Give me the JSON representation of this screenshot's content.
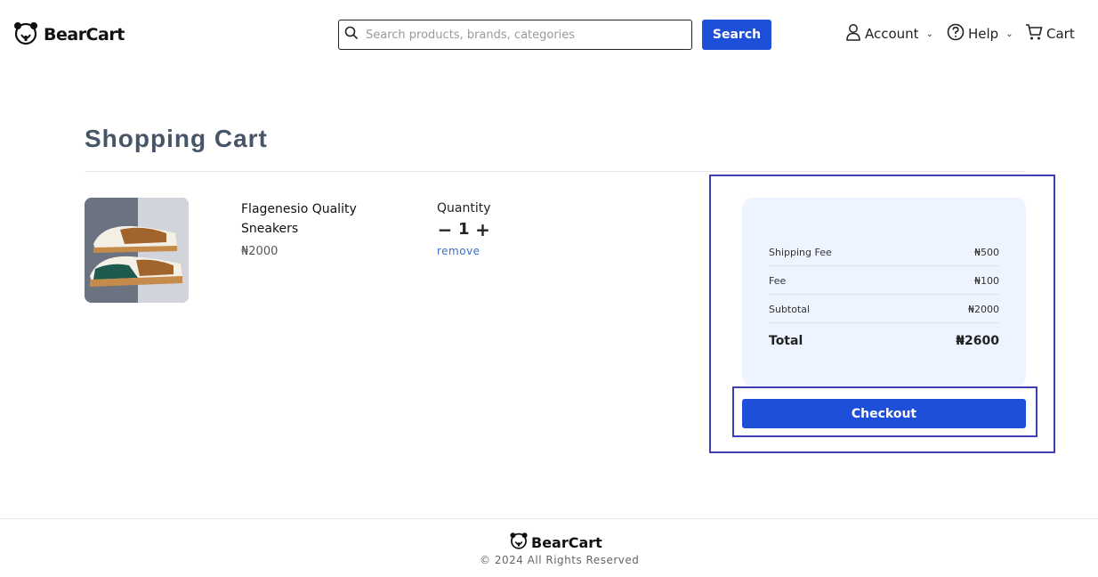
{
  "header": {
    "brand": "BearCart",
    "search_placeholder": "Search products, brands, categories",
    "search_button": "Search",
    "nav": {
      "account": "Account",
      "help": "Help",
      "cart": "Cart"
    }
  },
  "main": {
    "title": "Shopping Cart",
    "item": {
      "name": "Flagenesio Quality Sneakers",
      "price": "₦2000",
      "quantity_label": "Quantity",
      "quantity": "1",
      "remove": "remove"
    },
    "summary": {
      "rows": [
        {
          "label": "Shipping Fee",
          "value": "₦500"
        },
        {
          "label": "Fee",
          "value": "₦100"
        },
        {
          "label": "Subtotal",
          "value": "₦2000"
        }
      ],
      "total_label": "Total",
      "total_value": "₦2600",
      "checkout": "Checkout"
    }
  },
  "footer": {
    "brand": "BearCart",
    "copyright": "© 2024 All Rights Reserved"
  },
  "colors": {
    "primary": "#1d4fd8",
    "summary_bg": "#eef4ff",
    "title": "#475569",
    "highlight_outline": "#3f3fb5"
  },
  "icons": [
    "bear-logo-icon",
    "search-icon",
    "user-icon",
    "help-circle-icon",
    "cart-icon",
    "chevron-down-icon",
    "minus-icon",
    "plus-icon"
  ]
}
